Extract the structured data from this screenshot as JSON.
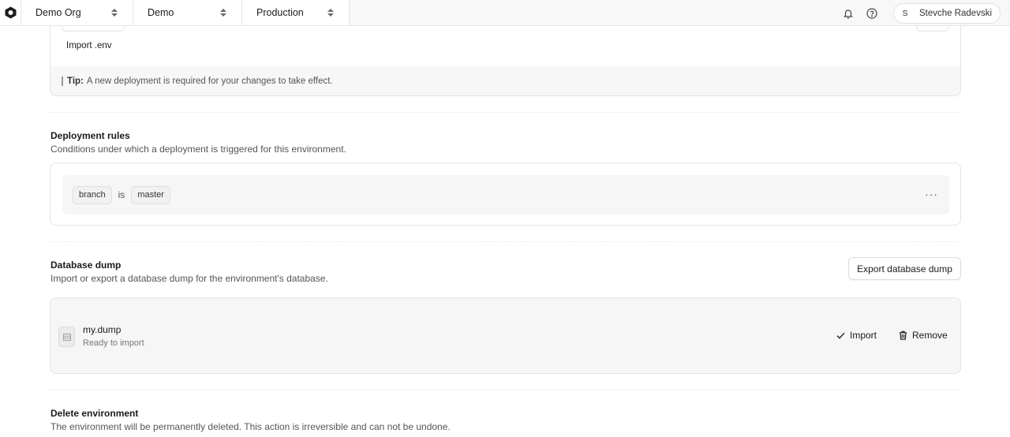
{
  "topbar": {
    "breadcrumbs": [
      {
        "label": "Demo Org"
      },
      {
        "label": "Demo"
      },
      {
        "label": "Production"
      }
    ],
    "user": {
      "initial": "S",
      "name": "Stevche Radevski"
    }
  },
  "env_panel": {
    "import_env_label": "Import .env",
    "tip_label": "Tip:",
    "tip_text": "A new deployment is required for your changes to take effect."
  },
  "deployment_rules": {
    "title": "Deployment rules",
    "description": "Conditions under which a deployment is triggered for this environment.",
    "rule": {
      "field": "branch",
      "operator": "is",
      "value": "master"
    },
    "more_label": "···"
  },
  "database_dump": {
    "title": "Database dump",
    "description": "Import or export a database dump for the environment's database.",
    "export_label": "Export database dump",
    "file": {
      "name": "my.dump",
      "status": "Ready to import"
    },
    "import_label": "Import",
    "remove_label": "Remove"
  },
  "delete_environment": {
    "title": "Delete environment",
    "description": "The environment will be permanently deleted. This action is irreversible and can not be undone."
  },
  "icons": {
    "logo": "hexagon-logo-icon",
    "notifications": "bell-icon",
    "help": "help-circle-icon",
    "file": "file-table-icon",
    "import": "check-icon",
    "remove": "trash-icon"
  }
}
